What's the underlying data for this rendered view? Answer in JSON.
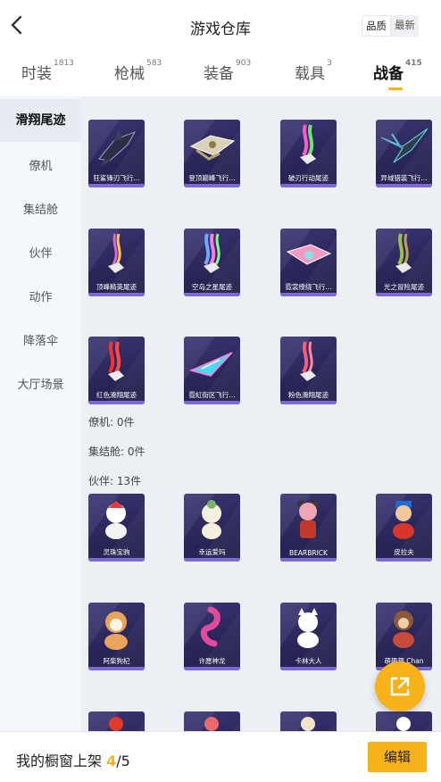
{
  "header": {
    "title": "游戏仓库",
    "sort_options": [
      "品质",
      "最新"
    ]
  },
  "tabs": [
    {
      "label": "时装",
      "count": "1813"
    },
    {
      "label": "枪械",
      "count": "583"
    },
    {
      "label": "装备",
      "count": "903"
    },
    {
      "label": "载具",
      "count": "3"
    },
    {
      "label": "战备",
      "count": "415"
    }
  ],
  "sidebar": [
    "滑翔尾迹",
    "僚机",
    "集结舱",
    "伙伴",
    "动作",
    "降落伞",
    "大厅场景"
  ],
  "trails": [
    "狂鲨锋刃飞行...",
    "登顶巅峰飞行...",
    "破刃行动尾迹",
    "异域猎装飞行...",
    "顶峰精英尾迹",
    "空岛之星尾迹",
    "霓裳缭绕飞行...",
    "光之冒险尾迹",
    "红色滑翔尾迹",
    "霓虹街区飞行...",
    "粉色滑翔尾迹"
  ],
  "sections": {
    "wingman": "僚机: 0件",
    "capsule": "集结舱: 0件",
    "partner": "伙伴: 13件"
  },
  "partners": [
    "灵珠宝驹",
    "幸运爱玛",
    "BEARBRICK",
    "皮拉夫",
    "阿柴狗杞",
    "许愿神龙",
    "卡林大人",
    "萌趣趣 Chan"
  ],
  "bottom": {
    "label": "我的橱窗上架",
    "count": "4",
    "total": "/5",
    "edit": "编辑"
  },
  "colors": {
    "accent": "#f7b21a",
    "card_bg": "#2a2658",
    "card_bar": "#7e67d6"
  },
  "icons": {
    "back": "chevron-left-icon",
    "fab": "share-external-icon"
  }
}
